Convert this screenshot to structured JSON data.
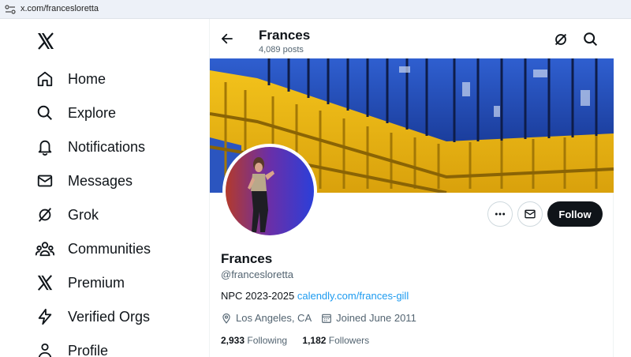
{
  "browser": {
    "url": "x.com/francesloretta"
  },
  "nav": {
    "items": [
      {
        "label": "Home",
        "icon": "home-icon"
      },
      {
        "label": "Explore",
        "icon": "search-icon"
      },
      {
        "label": "Notifications",
        "icon": "bell-icon"
      },
      {
        "label": "Messages",
        "icon": "mail-icon"
      },
      {
        "label": "Grok",
        "icon": "grok-icon"
      },
      {
        "label": "Communities",
        "icon": "communities-icon"
      },
      {
        "label": "Premium",
        "icon": "x-logo-icon"
      },
      {
        "label": "Verified Orgs",
        "icon": "lightning-icon"
      },
      {
        "label": "Profile",
        "icon": "person-icon"
      }
    ]
  },
  "header": {
    "name": "Frances",
    "posts": "4,089 posts"
  },
  "profile": {
    "name": "Frances",
    "handle": "@francesloretta",
    "bio_text": "NPC 2023-2025 ",
    "bio_link": "calendly.com/frances-gill",
    "location": "Los Angeles, CA",
    "joined": "Joined June 2011",
    "following_count": "2,933",
    "following_label": "Following",
    "followers_count": "1,182",
    "followers_label": "Followers",
    "follow_label": "Follow"
  },
  "colors": {
    "accent": "#1d9bf0",
    "text": "#0f1419",
    "muted": "#536471",
    "follow_bg": "#0f1419"
  }
}
